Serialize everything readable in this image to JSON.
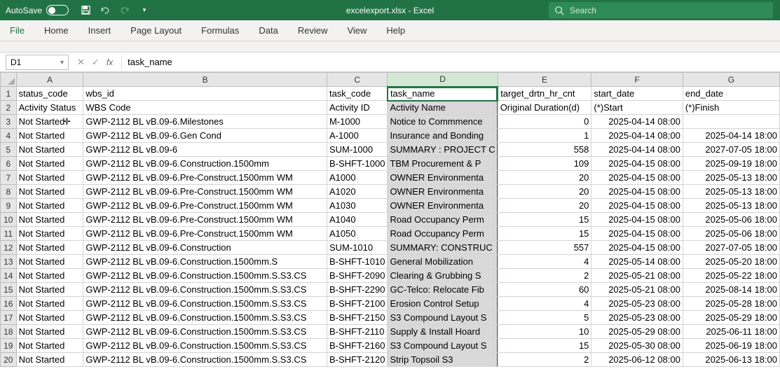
{
  "titlebar": {
    "autosave": "AutoSave",
    "filename": "excelexport.xlsx - Excel",
    "search_placeholder": "Search"
  },
  "ribbon": {
    "tabs": [
      "File",
      "Home",
      "Insert",
      "Page Layout",
      "Formulas",
      "Data",
      "Review",
      "View",
      "Help"
    ]
  },
  "namebox": "D1",
  "formula": "task_name",
  "columns": [
    "A",
    "B",
    "C",
    "D",
    "E",
    "F",
    "G"
  ],
  "selected_col_index": 3,
  "rows": [
    {
      "r": 1,
      "A": "status_code",
      "B": "wbs_id",
      "C": "task_code",
      "D": "task_name",
      "E": "target_drtn_hr_cnt",
      "F": "start_date",
      "G": "end_date",
      "E_num": false,
      "F_num": false,
      "G_num": false
    },
    {
      "r": 2,
      "A": "Activity Status",
      "B": "WBS Code",
      "C": "Activity ID",
      "D": "Activity Name",
      "E": "Original Duration(d)",
      "F": "(*)Start",
      "G": "(*)Finish",
      "E_num": false,
      "F_num": false,
      "G_num": false
    },
    {
      "r": 3,
      "A": "Not Started",
      "B": "GWP-2112 BL vB.09-6.Milestones",
      "C": "M-1000",
      "D": "Notice to Commmence",
      "E": "0",
      "F": "2025-04-14 08:00",
      "G": "",
      "E_num": true,
      "F_num": true,
      "G_num": true
    },
    {
      "r": 4,
      "A": "Not Started",
      "B": "GWP-2112 BL vB.09-6.Gen Cond",
      "C": "A-1000",
      "D": "Insurance and Bonding",
      "E": "1",
      "F": "2025-04-14 08:00",
      "G": "2025-04-14 18:00",
      "E_num": true,
      "F_num": true,
      "G_num": true
    },
    {
      "r": 5,
      "A": "Not Started",
      "B": "GWP-2112 BL vB.09-6",
      "C": "SUM-1000",
      "D": "SUMMARY : PROJECT C",
      "E": "558",
      "F": "2025-04-14 08:00",
      "G": "2027-07-05 18:00",
      "E_num": true,
      "F_num": true,
      "G_num": true
    },
    {
      "r": 6,
      "A": "Not Started",
      "B": "GWP-2112 BL vB.09-6.Construction.1500mm",
      "C": "B-SHFT-1000",
      "D": "TBM Procurement & P",
      "E": "109",
      "F": "2025-04-15 08:00",
      "G": "2025-09-19 18:00",
      "E_num": true,
      "F_num": true,
      "G_num": true
    },
    {
      "r": 7,
      "A": "Not Started",
      "B": "GWP-2112 BL vB.09-6.Pre-Construct.1500mm WM",
      "C": "A1000",
      "D": "OWNER Environmenta",
      "E": "20",
      "F": "2025-04-15 08:00",
      "G": "2025-05-13 18:00",
      "E_num": true,
      "F_num": true,
      "G_num": true
    },
    {
      "r": 8,
      "A": "Not Started",
      "B": "GWP-2112 BL vB.09-6.Pre-Construct.1500mm WM",
      "C": "A1020",
      "D": "OWNER Environmenta",
      "E": "20",
      "F": "2025-04-15 08:00",
      "G": "2025-05-13 18:00",
      "E_num": true,
      "F_num": true,
      "G_num": true
    },
    {
      "r": 9,
      "A": "Not Started",
      "B": "GWP-2112 BL vB.09-6.Pre-Construct.1500mm WM",
      "C": "A1030",
      "D": "OWNER Environmenta",
      "E": "20",
      "F": "2025-04-15 08:00",
      "G": "2025-05-13 18:00",
      "E_num": true,
      "F_num": true,
      "G_num": true
    },
    {
      "r": 10,
      "A": "Not Started",
      "B": "GWP-2112 BL vB.09-6.Pre-Construct.1500mm WM",
      "C": "A1040",
      "D": "Road Occupancy Perm",
      "E": "15",
      "F": "2025-04-15 08:00",
      "G": "2025-05-06 18:00",
      "E_num": true,
      "F_num": true,
      "G_num": true
    },
    {
      "r": 11,
      "A": "Not Started",
      "B": "GWP-2112 BL vB.09-6.Pre-Construct.1500mm WM",
      "C": "A1050",
      "D": "Road Occupancy Perm",
      "E": "15",
      "F": "2025-04-15 08:00",
      "G": "2025-05-06 18:00",
      "E_num": true,
      "F_num": true,
      "G_num": true
    },
    {
      "r": 12,
      "A": "Not Started",
      "B": "GWP-2112 BL vB.09-6.Construction",
      "C": "SUM-1010",
      "D": "SUMMARY: CONSTRUC",
      "E": "557",
      "F": "2025-04-15 08:00",
      "G": "2027-07-05 18:00",
      "E_num": true,
      "F_num": true,
      "G_num": true
    },
    {
      "r": 13,
      "A": "Not Started",
      "B": "GWP-2112 BL vB.09-6.Construction.1500mm.S",
      "C": "B-SHFT-1010",
      "D": "General Mobilization",
      "E": "4",
      "F": "2025-05-14 08:00",
      "G": "2025-05-20 18:00",
      "E_num": true,
      "F_num": true,
      "G_num": true
    },
    {
      "r": 14,
      "A": "Not Started",
      "B": "GWP-2112 BL vB.09-6.Construction.1500mm.S.S3.CS",
      "C": "B-SHFT-2090",
      "D": "Clearing & Grubbing S",
      "E": "2",
      "F": "2025-05-21 08:00",
      "G": "2025-05-22 18:00",
      "E_num": true,
      "F_num": true,
      "G_num": true
    },
    {
      "r": 15,
      "A": "Not Started",
      "B": "GWP-2112 BL vB.09-6.Construction.1500mm.S.S3.CS",
      "C": "B-SHFT-2290",
      "D": "GC-Telco: Relocate Fib",
      "E": "60",
      "F": "2025-05-21 08:00",
      "G": "2025-08-14 18:00",
      "E_num": true,
      "F_num": true,
      "G_num": true
    },
    {
      "r": 16,
      "A": "Not Started",
      "B": "GWP-2112 BL vB.09-6.Construction.1500mm.S.S3.CS",
      "C": "B-SHFT-2100",
      "D": "Erosion Control Setup",
      "E": "4",
      "F": "2025-05-23 08:00",
      "G": "2025-05-28 18:00",
      "E_num": true,
      "F_num": true,
      "G_num": true
    },
    {
      "r": 17,
      "A": "Not Started",
      "B": "GWP-2112 BL vB.09-6.Construction.1500mm.S.S3.CS",
      "C": "B-SHFT-2150",
      "D": "S3 Compound Layout S",
      "E": "5",
      "F": "2025-05-23 08:00",
      "G": "2025-05-29 18:00",
      "E_num": true,
      "F_num": true,
      "G_num": true
    },
    {
      "r": 18,
      "A": "Not Started",
      "B": "GWP-2112 BL vB.09-6.Construction.1500mm.S.S3.CS",
      "C": "B-SHFT-2110",
      "D": "Supply & Install Hoard",
      "E": "10",
      "F": "2025-05-29 08:00",
      "G": "2025-06-11 18:00",
      "E_num": true,
      "F_num": true,
      "G_num": true
    },
    {
      "r": 19,
      "A": "Not Started",
      "B": "GWP-2112 BL vB.09-6.Construction.1500mm.S.S3.CS",
      "C": "B-SHFT-2160",
      "D": "S3 Compound Layout S",
      "E": "15",
      "F": "2025-05-30 08:00",
      "G": "2025-06-19 18:00",
      "E_num": true,
      "F_num": true,
      "G_num": true
    },
    {
      "r": 20,
      "A": "Not Started",
      "B": "GWP-2112 BL vB.09-6.Construction.1500mm.S.S3.CS",
      "C": "B-SHFT-2120",
      "D": "Strip Topsoil S3",
      "E": "2",
      "F": "2025-06-12 08:00",
      "G": "2025-06-13 18:00",
      "E_num": true,
      "F_num": true,
      "G_num": true
    }
  ]
}
